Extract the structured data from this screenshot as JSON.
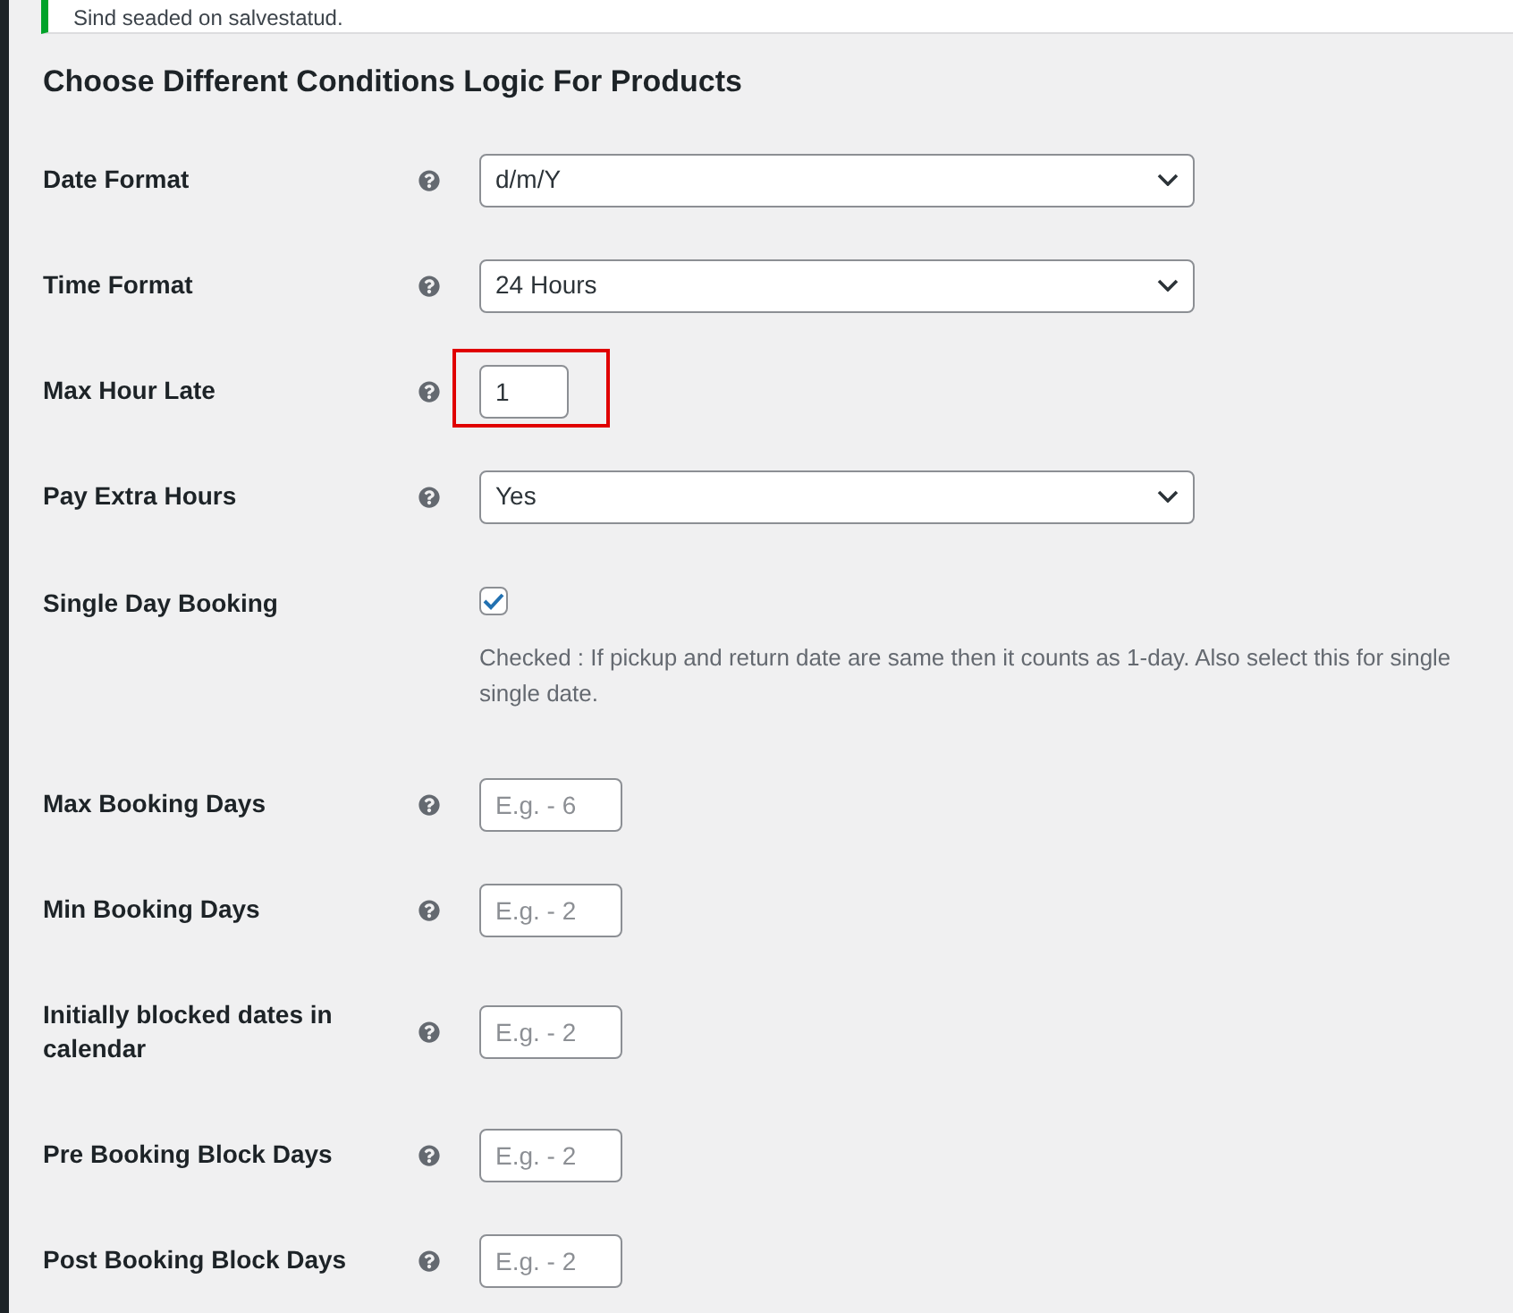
{
  "notice": {
    "text": "Sind seaded on salvestatud."
  },
  "title": "Choose Different Conditions Logic For Products",
  "fields": [
    {
      "kind": "select",
      "label": "Date Format",
      "value": "d/m/Y"
    },
    {
      "kind": "select",
      "label": "Time Format",
      "value": "24 Hours"
    },
    {
      "kind": "number",
      "label": "Max Hour Late",
      "value": "1",
      "highlighted": true
    },
    {
      "kind": "select",
      "label": "Pay Extra Hours",
      "value": "Yes"
    },
    {
      "kind": "checkbox",
      "label": "Single Day Booking",
      "checked": true,
      "description": [
        "Checked : If pickup and return date are same then it counts as 1-day. Also select this for single",
        "single date."
      ]
    },
    {
      "kind": "number",
      "label": "Max Booking Days",
      "placeholder": "E.g. - 6"
    },
    {
      "kind": "number",
      "label": "Min Booking Days",
      "placeholder": "E.g. - 2"
    },
    {
      "kind": "number",
      "label": "Initially blocked dates in calendar",
      "placeholder": "E.g. - 2"
    },
    {
      "kind": "number",
      "label": "Pre Booking Block Days",
      "placeholder": "E.g. - 2"
    },
    {
      "kind": "number",
      "label": "Post Booking Block Days",
      "placeholder": "E.g. - 2"
    }
  ]
}
